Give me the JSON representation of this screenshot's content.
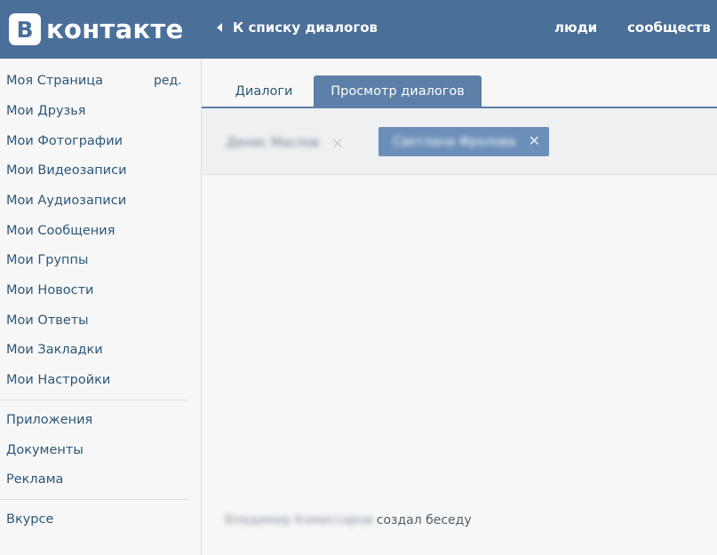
{
  "header": {
    "logo_letter": "В",
    "logo_text": "контакте",
    "back_link": "К списку диалогов",
    "nav": {
      "people": "люди",
      "communities": "сообществ"
    }
  },
  "sidebar": {
    "edit_label": "ред.",
    "items": [
      "Моя Страница",
      "Мои Друзья",
      "Мои Фотографии",
      "Мои Видеозаписи",
      "Мои Аудиозаписи",
      "Мои Сообщения",
      "Мои Группы",
      "Мои Новости",
      "Мои Ответы",
      "Мои Закладки",
      "Мои Настройки",
      "Приложения",
      "Документы",
      "Реклама",
      "Вкурсе"
    ]
  },
  "tabs": {
    "dialogs": "Диалоги",
    "view": "Просмотр диалогов"
  },
  "filters": {
    "chip_one": "Денис Маслов",
    "chip_two": "Светлана Фролова",
    "close_glyph": "✕"
  },
  "conversation": {
    "blurred_name": "Владимир Комиссаров",
    "created_text": "создал беседу"
  },
  "colors": {
    "header": "#4a6f99",
    "link": "#2b587a",
    "tab_active": "#5b7fa6"
  }
}
